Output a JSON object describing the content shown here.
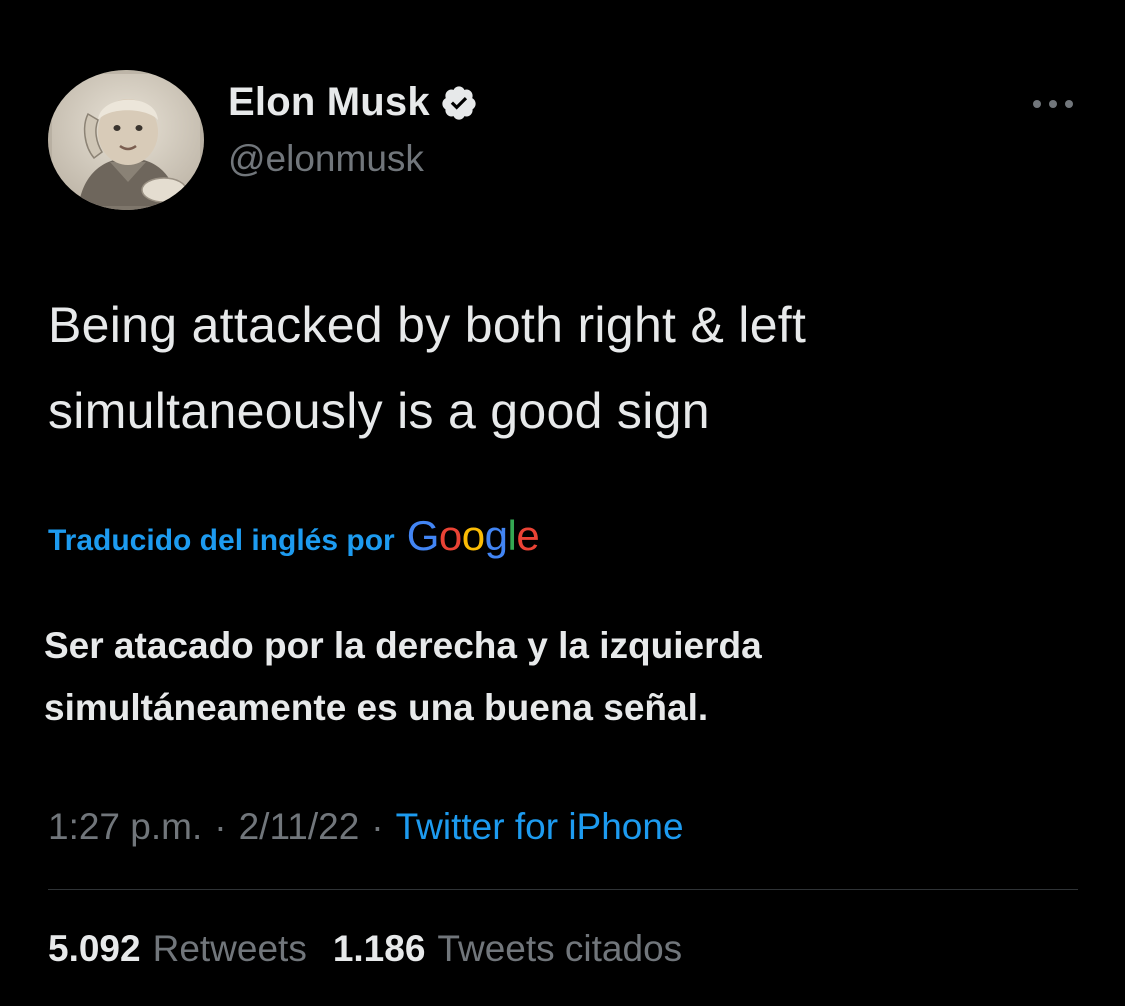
{
  "author": {
    "display_name": "Elon Musk",
    "handle": "@elonmusk",
    "verified": true,
    "avatar_icon": "vintage-child-telephone-photo"
  },
  "tweet": {
    "lines": [
      "Being attacked by both right & left",
      "simultaneously is a good sign"
    ]
  },
  "translation": {
    "label": "Traducido del inglés por",
    "provider_letters": [
      {
        "char": "G",
        "color": "#4285f4"
      },
      {
        "char": "o",
        "color": "#ea4335"
      },
      {
        "char": "o",
        "color": "#fbbc05"
      },
      {
        "char": "g",
        "color": "#4285f4"
      },
      {
        "char": "l",
        "color": "#34a853"
      },
      {
        "char": "e",
        "color": "#ea4335"
      }
    ],
    "lines": [
      "Ser atacado por la derecha y la izquierda",
      "simultáneamente es una buena señal."
    ]
  },
  "meta": {
    "time": "1:27 p.m.",
    "date": "2/11/22",
    "separator": "·",
    "source": "Twitter for iPhone"
  },
  "stats": {
    "retweets_count": "5.092",
    "retweets_label": "Retweets",
    "quotes_count": "1.186",
    "quotes_label": "Tweets citados"
  },
  "colors": {
    "background": "#000000",
    "text_primary": "#e7e9ea",
    "text_secondary": "#71767b",
    "accent": "#1d9bf0",
    "divider": "#2f3336"
  },
  "icons": {
    "verified": "verified-badge-icon",
    "more": "more-options-icon"
  }
}
